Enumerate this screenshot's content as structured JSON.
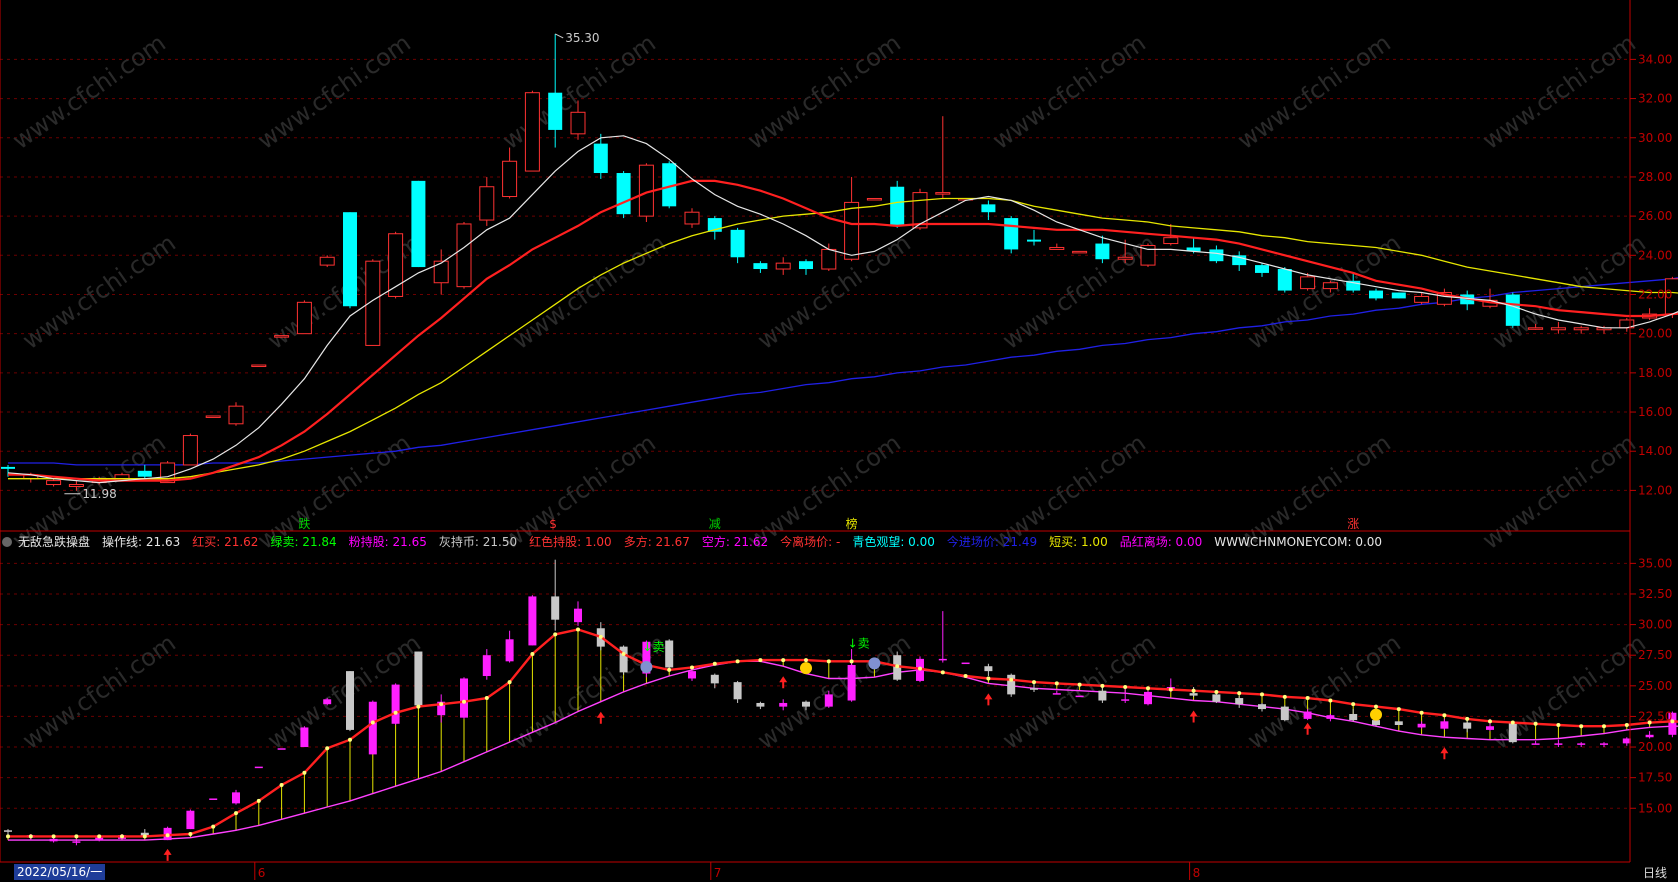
{
  "colors": {
    "grid": "#6b0000",
    "axis": "#c00000",
    "up": "#ff3232",
    "down": "#00ffff",
    "ma5": "#e6e6e6",
    "ma10": "#ff2020",
    "ma20": "#e6e600",
    "ma60": "#2020e6"
  },
  "main_panel": {
    "ylim": [
      11,
      35.5
    ],
    "price_axis_labels": [
      "34.00",
      "32.00",
      "30.00",
      "28.00",
      "26.00",
      "24.00",
      "22.00",
      "20.00",
      "18.00",
      "16.00",
      "14.00",
      "12.00"
    ],
    "high_label": "35.30",
    "low_label": "11.98",
    "signals": [
      {
        "i": 13,
        "text": "跌",
        "color": "#00d000"
      },
      {
        "i": 24,
        "text": "$",
        "color": "#ff3232"
      },
      {
        "i": 31,
        "text": "减",
        "color": "#00d000"
      },
      {
        "i": 37,
        "text": "榜",
        "color": "#e6e600"
      },
      {
        "i": 59,
        "text": "涨",
        "color": "#ff3232"
      }
    ]
  },
  "info_bar": {
    "title": "无敌急跌操盘",
    "items": [
      {
        "label": "操作线: 21.63",
        "color": "#e6e6e6"
      },
      {
        "label": "红买: 21.62",
        "color": "#ff3232"
      },
      {
        "label": "绿卖: 21.84",
        "color": "#00ff00"
      },
      {
        "label": "粉持股: 21.65",
        "color": "#ff00ff"
      },
      {
        "label": "灰持币: 21.50",
        "color": "#c8c8c8"
      },
      {
        "label": "红色持股: 1.00",
        "color": "#ff3232"
      },
      {
        "label": "多方: 21.67",
        "color": "#ff3232"
      },
      {
        "label": "空方: 21.62",
        "color": "#ff00ff"
      },
      {
        "label": "今离场价: -",
        "color": "#ff3232"
      },
      {
        "label": "青色观望: 0.00",
        "color": "#00ffff"
      },
      {
        "label": "今进场价: 21.49",
        "color": "#2020e6"
      },
      {
        "label": "短买: 1.00",
        "color": "#e6e600"
      },
      {
        "label": "品红离场: 0.00",
        "color": "#ff00ff"
      },
      {
        "label": "WWWCHNMONEYCOM: 0.00",
        "color": "#e6e6e6"
      }
    ]
  },
  "lower_panel": {
    "ylim": [
      12,
      36.5
    ],
    "axis_labels": [
      "35.00",
      "32.50",
      "30.00",
      "27.50",
      "25.00",
      "22.50",
      "20.00",
      "17.50",
      "15.00"
    ],
    "sell_label": "↓卖",
    "buy_label": "买"
  },
  "time_axis": {
    "labels": [
      {
        "i": 11,
        "text": "6"
      },
      {
        "i": 31,
        "text": "7"
      },
      {
        "i": 52,
        "text": "8"
      }
    ],
    "date_label": "2022/05/16/一",
    "period": "日线"
  },
  "watermark": "www.cfchi.com",
  "chart_data": {
    "type": "candlestick",
    "ohlc": [
      [
        13.2,
        13.1,
        13.3,
        12.7
      ],
      [
        12.6,
        12.8,
        12.9,
        12.4
      ],
      [
        12.3,
        12.5,
        12.6,
        12.2
      ],
      [
        12.2,
        12.3,
        12.5,
        11.98
      ],
      [
        12.4,
        12.6,
        12.7,
        12.3
      ],
      [
        12.5,
        12.8,
        12.9,
        12.5
      ],
      [
        13.0,
        12.7,
        13.3,
        12.6
      ],
      [
        12.4,
        13.4,
        13.5,
        12.4
      ],
      [
        13.3,
        14.8,
        14.9,
        13.3
      ],
      [
        15.8,
        15.8,
        15.8,
        15.8
      ],
      [
        15.4,
        16.3,
        16.5,
        15.3
      ],
      [
        18.4,
        18.4,
        18.4,
        18.4
      ],
      [
        19.9,
        19.9,
        19.9,
        19.9
      ],
      [
        20.0,
        21.6,
        21.7,
        20.0
      ],
      [
        23.5,
        23.9,
        24.0,
        23.4
      ],
      [
        26.2,
        21.4,
        26.2,
        21.3
      ],
      [
        19.4,
        23.7,
        23.8,
        19.4
      ],
      [
        21.9,
        25.1,
        25.2,
        21.8
      ],
      [
        27.8,
        23.4,
        27.8,
        23.4
      ],
      [
        22.6,
        23.7,
        24.3,
        22.0
      ],
      [
        22.4,
        25.6,
        25.7,
        22.3
      ],
      [
        25.8,
        27.5,
        28.0,
        25.5
      ],
      [
        27.0,
        28.8,
        29.5,
        26.9
      ],
      [
        28.3,
        32.3,
        32.4,
        28.3
      ],
      [
        32.3,
        30.4,
        35.3,
        29.5
      ],
      [
        30.2,
        31.3,
        31.9,
        29.9
      ],
      [
        29.7,
        28.2,
        30.2,
        27.9
      ],
      [
        28.2,
        26.1,
        28.3,
        25.9
      ],
      [
        26.0,
        28.6,
        28.7,
        25.7
      ],
      [
        28.7,
        26.5,
        28.8,
        26.4
      ],
      [
        25.6,
        26.2,
        26.4,
        25.4
      ],
      [
        25.9,
        25.2,
        26.0,
        24.8
      ],
      [
        25.3,
        23.9,
        25.4,
        23.6
      ],
      [
        23.6,
        23.3,
        23.7,
        23.1
      ],
      [
        23.3,
        23.6,
        23.9,
        23.0
      ],
      [
        23.7,
        23.3,
        23.8,
        23.0
      ],
      [
        23.3,
        24.3,
        24.6,
        23.2
      ],
      [
        23.8,
        26.7,
        28.0,
        23.7
      ],
      [
        26.9,
        26.9,
        26.9,
        26.9
      ],
      [
        27.5,
        25.5,
        27.8,
        25.4
      ],
      [
        25.4,
        27.2,
        27.4,
        25.3
      ],
      [
        27.2,
        27.2,
        31.1,
        26.9
      ],
      [
        26.9,
        26.9,
        26.9,
        26.9
      ],
      [
        26.6,
        26.2,
        26.8,
        25.8
      ],
      [
        25.9,
        24.3,
        26.0,
        24.1
      ],
      [
        24.8,
        24.7,
        25.3,
        24.5
      ],
      [
        24.3,
        24.4,
        24.6,
        24.3
      ],
      [
        24.2,
        24.2,
        24.2,
        24.2
      ],
      [
        24.6,
        23.8,
        25.0,
        23.6
      ],
      [
        23.8,
        23.9,
        24.8,
        23.6
      ],
      [
        23.5,
        24.5,
        24.6,
        23.4
      ],
      [
        24.6,
        24.9,
        25.6,
        24.5
      ],
      [
        24.4,
        24.2,
        24.9,
        24.1
      ],
      [
        24.3,
        23.7,
        24.5,
        23.6
      ],
      [
        24.0,
        23.5,
        24.2,
        23.2
      ],
      [
        23.5,
        23.1,
        23.6,
        22.9
      ],
      [
        23.3,
        22.2,
        23.4,
        22.1
      ],
      [
        22.3,
        22.9,
        23.1,
        22.2
      ],
      [
        22.3,
        22.6,
        22.7,
        22.1
      ],
      [
        22.7,
        22.2,
        23.1,
        22.1
      ],
      [
        22.2,
        21.8,
        22.3,
        21.7
      ],
      [
        22.1,
        21.8,
        22.1,
        21.8
      ],
      [
        21.6,
        21.9,
        22.1,
        21.5
      ],
      [
        21.5,
        22.1,
        22.3,
        21.4
      ],
      [
        22.0,
        21.5,
        22.2,
        21.2
      ],
      [
        21.4,
        21.7,
        22.3,
        21.3
      ],
      [
        22.0,
        20.4,
        22.1,
        20.3
      ],
      [
        20.3,
        20.3,
        20.5,
        20.2
      ],
      [
        20.2,
        20.3,
        20.6,
        20.0
      ],
      [
        20.2,
        20.3,
        20.4,
        20.0
      ],
      [
        20.2,
        20.3,
        20.4,
        20.0
      ],
      [
        20.3,
        20.7,
        20.8,
        20.1
      ],
      [
        20.8,
        21.0,
        21.3,
        20.7
      ],
      [
        21.0,
        22.8,
        22.9,
        20.8
      ],
      [
        22.9,
        22.5,
        23.4,
        22.2
      ],
      [
        22.4,
        21.6,
        22.5,
        21.5
      ],
      [
        21.4,
        21.5,
        21.7,
        21.3
      ],
      [
        21.5,
        21.6,
        21.9,
        21.3
      ]
    ],
    "ma5": [
      12.9,
      12.8,
      12.6,
      12.5,
      12.4,
      12.5,
      12.6,
      12.7,
      13.1,
      13.6,
      14.3,
      15.2,
      16.4,
      17.7,
      19.4,
      20.9,
      21.7,
      22.4,
      23.1,
      23.6,
      24.4,
      25.3,
      25.9,
      27.1,
      28.3,
      29.3,
      30.0,
      30.1,
      29.7,
      28.9,
      27.9,
      27.1,
      26.5,
      26.1,
      25.6,
      25.0,
      24.3,
      24.0,
      24.2,
      24.8,
      25.6,
      26.2,
      26.8,
      27.0,
      26.8,
      26.3,
      25.7,
      25.3,
      24.9,
      24.6,
      24.3,
      24.3,
      24.2,
      24.1,
      23.9,
      23.6,
      23.3,
      23.0,
      22.8,
      22.6,
      22.4,
      22.2,
      22.1,
      21.9,
      21.8,
      21.7,
      21.4,
      21.0,
      20.7,
      20.5,
      20.3,
      20.3,
      20.6,
      21.0,
      21.5,
      21.8,
      22.0,
      21.8
    ],
    "ma10": [
      12.8,
      12.8,
      12.7,
      12.6,
      12.5,
      12.5,
      12.5,
      12.5,
      12.6,
      12.9,
      13.3,
      13.7,
      14.3,
      15.0,
      15.9,
      16.9,
      17.9,
      18.9,
      19.9,
      20.8,
      21.8,
      22.8,
      23.5,
      24.3,
      24.9,
      25.5,
      26.2,
      26.7,
      27.2,
      27.5,
      27.8,
      27.8,
      27.6,
      27.3,
      26.9,
      26.4,
      25.9,
      25.6,
      25.6,
      25.5,
      25.6,
      25.6,
      25.6,
      25.6,
      25.5,
      25.4,
      25.3,
      25.3,
      25.3,
      25.2,
      25.1,
      25.0,
      24.9,
      24.8,
      24.6,
      24.3,
      24.0,
      23.7,
      23.4,
      23.1,
      22.7,
      22.5,
      22.3,
      22.0,
      21.8,
      21.6,
      21.5,
      21.4,
      21.2,
      21.1,
      21.0,
      20.9,
      20.9,
      21.0,
      21.1,
      21.1,
      21.2,
      21.3
    ],
    "ma20": [
      12.6,
      12.6,
      12.6,
      12.6,
      12.6,
      12.6,
      12.6,
      12.6,
      12.7,
      12.9,
      13.1,
      13.3,
      13.6,
      14.0,
      14.5,
      15.0,
      15.6,
      16.2,
      16.9,
      17.5,
      18.3,
      19.1,
      19.9,
      20.7,
      21.5,
      22.3,
      23.0,
      23.6,
      24.1,
      24.6,
      25.0,
      25.3,
      25.6,
      25.8,
      26.0,
      26.1,
      26.2,
      26.4,
      26.5,
      26.7,
      26.8,
      26.9,
      26.9,
      26.9,
      26.8,
      26.5,
      26.3,
      26.1,
      25.9,
      25.8,
      25.7,
      25.5,
      25.4,
      25.3,
      25.2,
      25.0,
      24.9,
      24.7,
      24.6,
      24.5,
      24.4,
      24.2,
      24.0,
      23.7,
      23.4,
      23.2,
      23.0,
      22.8,
      22.6,
      22.4,
      22.3,
      22.2,
      22.1,
      22.1,
      22.0,
      22.0,
      21.9,
      21.9
    ],
    "ma60": [
      13.4,
      13.4,
      13.4,
      13.3,
      13.3,
      13.3,
      13.3,
      13.3,
      13.3,
      13.4,
      13.4,
      13.4,
      13.5,
      13.6,
      13.7,
      13.8,
      13.9,
      14.0,
      14.2,
      14.3,
      14.5,
      14.7,
      14.9,
      15.1,
      15.3,
      15.5,
      15.7,
      15.9,
      16.1,
      16.3,
      16.5,
      16.7,
      16.9,
      17.0,
      17.2,
      17.4,
      17.5,
      17.7,
      17.8,
      18.0,
      18.1,
      18.3,
      18.4,
      18.6,
      18.8,
      18.9,
      19.1,
      19.2,
      19.4,
      19.5,
      19.7,
      19.8,
      20.0,
      20.1,
      20.3,
      20.4,
      20.6,
      20.7,
      20.9,
      21.0,
      21.2,
      21.3,
      21.5,
      21.6,
      21.8,
      21.9,
      22.1,
      22.2,
      22.3,
      22.4,
      22.5,
      22.6,
      22.7,
      22.8,
      23.0,
      23.1,
      23.3,
      23.5
    ],
    "lower_upper_line": [
      12.7,
      12.7,
      12.7,
      12.7,
      12.7,
      12.7,
      12.7,
      12.8,
      12.9,
      13.5,
      14.6,
      15.6,
      16.9,
      17.9,
      19.9,
      20.6,
      22.0,
      22.8,
      23.3,
      23.5,
      23.7,
      24.0,
      25.3,
      27.6,
      29.2,
      29.6,
      29.0,
      27.6,
      26.7,
      26.3,
      26.5,
      26.8,
      27.0,
      27.1,
      27.1,
      27.1,
      27.0,
      27.0,
      27.0,
      26.6,
      26.4,
      26.1,
      25.8,
      25.6,
      25.5,
      25.3,
      25.2,
      25.1,
      25.0,
      24.9,
      24.8,
      24.7,
      24.6,
      24.5,
      24.4,
      24.3,
      24.1,
      24.0,
      23.8,
      23.5,
      23.3,
      23.1,
      22.8,
      22.6,
      22.3,
      22.1,
      22.0,
      21.9,
      21.8,
      21.7,
      21.7,
      21.8,
      22.0,
      22.1,
      22.0,
      21.9,
      21.8,
      21.8
    ],
    "lower_lower_line": [
      12.4,
      12.4,
      12.4,
      12.4,
      12.4,
      12.4,
      12.4,
      12.5,
      12.6,
      12.9,
      13.2,
      13.6,
      14.1,
      14.6,
      15.1,
      15.6,
      16.2,
      16.8,
      17.4,
      18.0,
      18.8,
      19.6,
      20.4,
      21.2,
      22.0,
      22.9,
      23.7,
      24.5,
      25.2,
      25.8,
      26.3,
      26.7,
      27.0,
      27.0,
      26.6,
      26.0,
      25.6,
      25.6,
      25.7,
      26.1,
      26.3,
      26.1,
      25.7,
      25.2,
      25.0,
      24.8,
      24.7,
      24.6,
      24.5,
      24.4,
      24.2,
      24.0,
      23.8,
      23.7,
      23.5,
      23.3,
      23.1,
      22.8,
      22.4,
      22.1,
      21.7,
      21.3,
      21.0,
      20.8,
      20.7,
      20.6,
      20.6,
      20.6,
      20.7,
      20.9,
      21.1,
      21.4,
      21.6,
      21.7,
      21.7,
      21.8,
      21.8,
      21.8
    ]
  }
}
